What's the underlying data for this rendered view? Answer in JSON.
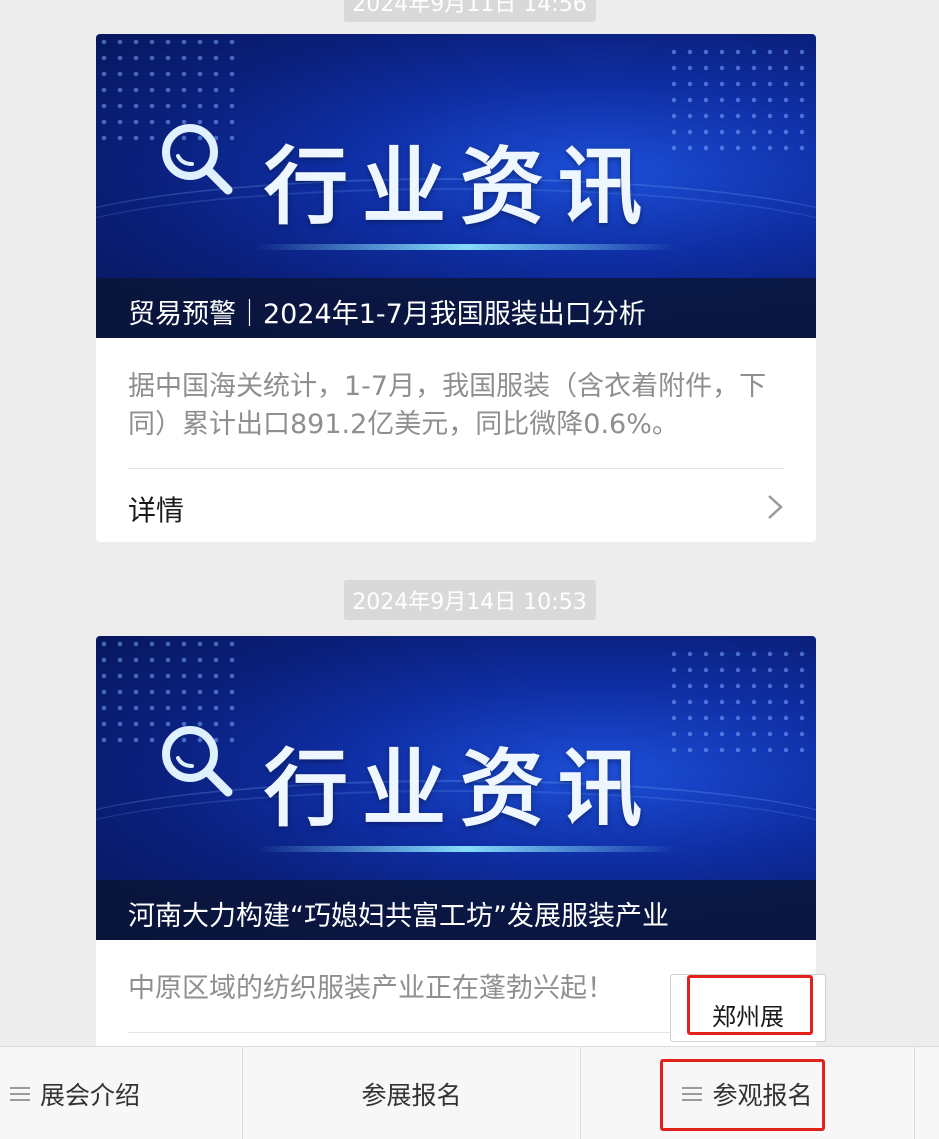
{
  "articles": [
    {
      "timestamp": "2024年9月11日 14:56",
      "banner_title": "行业资讯",
      "caption": "贸易预警｜2024年1-7月我国服装出口分析",
      "summary": "据中国海关统计，1-7月，我国服装（含衣着附件，下同）累计出口891.2亿美元，同比微降0.6%。",
      "detail_label": "详情"
    },
    {
      "timestamp": "2024年9月14日 10:53",
      "banner_title": "行业资讯",
      "caption": "河南大力构建“巧媳妇共富工坊”发展服装产业",
      "summary": "中原区域的纺织服装产业正在蓬勃兴起！"
    }
  ],
  "popup_menu": {
    "items": [
      "郑州展"
    ]
  },
  "bottom_menu": {
    "items": [
      "展会介绍",
      "参展报名",
      "参观报名"
    ]
  },
  "colors": {
    "highlight": "#e0221b",
    "banner_blue": "#0f2fa6",
    "timestamp_bg": "#d9d9d9",
    "page_bg": "#ededed"
  },
  "icons": [
    "magnifier-icon",
    "chevron-right-icon",
    "menu-lines-icon"
  ]
}
